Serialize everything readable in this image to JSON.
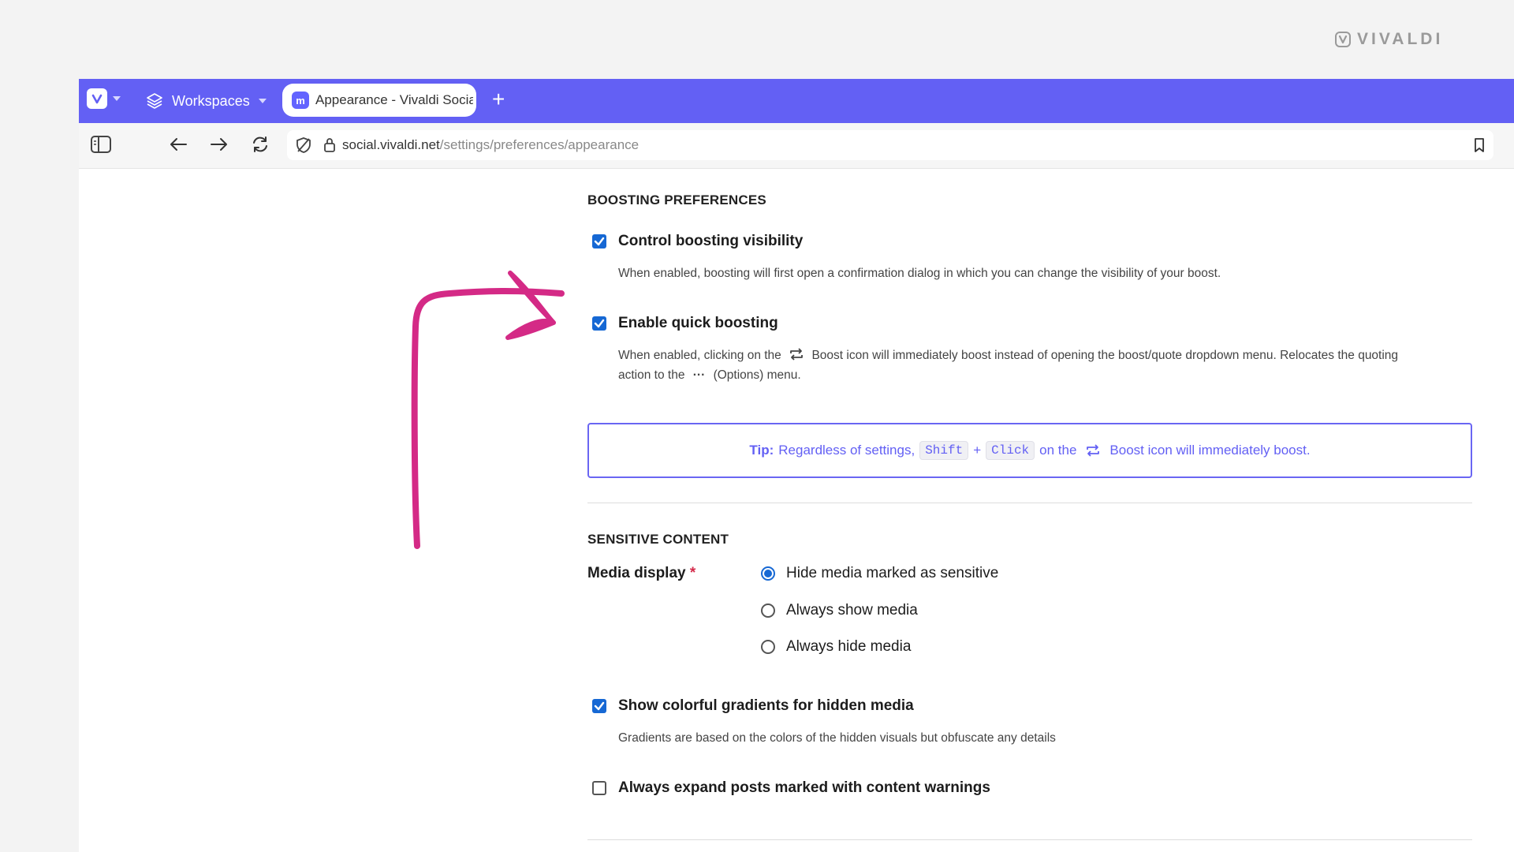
{
  "brand": {
    "name": "VIVALDI"
  },
  "browser": {
    "workspaces_label": "Workspaces",
    "tab_title": "Appearance - Vivaldi Social",
    "new_tab": "+",
    "url_host": "social.vivaldi.net",
    "url_path": "/settings/preferences/appearance",
    "accent": "#6360f4"
  },
  "boosting": {
    "heading": "BOOSTING PREFERENCES",
    "control_visibility": {
      "label": "Control boosting visibility",
      "desc": "When enabled, boosting will first open a confirmation dialog in which you can change the visibility of your boost.",
      "checked": true
    },
    "quick_boost": {
      "label": "Enable quick boosting",
      "desc_a": "When enabled, clicking on the",
      "desc_b": "Boost icon will immediately boost instead of opening the boost/quote dropdown menu. Relocates the quoting",
      "desc_c": "action to the",
      "desc_d": "(Options) menu.",
      "checked": true
    },
    "tip": {
      "prefix": "Tip:",
      "text_a": "Regardless of settings,",
      "key1": "Shift",
      "plus": "+",
      "key2": "Click",
      "text_b": "on the",
      "text_c": "Boost icon will immediately boost."
    }
  },
  "sensitive": {
    "heading": "SENSITIVE CONTENT",
    "media_label": "Media display",
    "required_mark": "*",
    "options": [
      {
        "label": "Hide media marked as sensitive",
        "selected": true
      },
      {
        "label": "Always show media",
        "selected": false
      },
      {
        "label": "Always hide media",
        "selected": false
      }
    ],
    "gradients": {
      "label": "Show colorful gradients for hidden media",
      "desc": "Gradients are based on the colors of the hidden visuals but obfuscate any details",
      "checked": true
    },
    "expand": {
      "label": "Always expand posts marked with content warnings",
      "checked": false
    }
  }
}
